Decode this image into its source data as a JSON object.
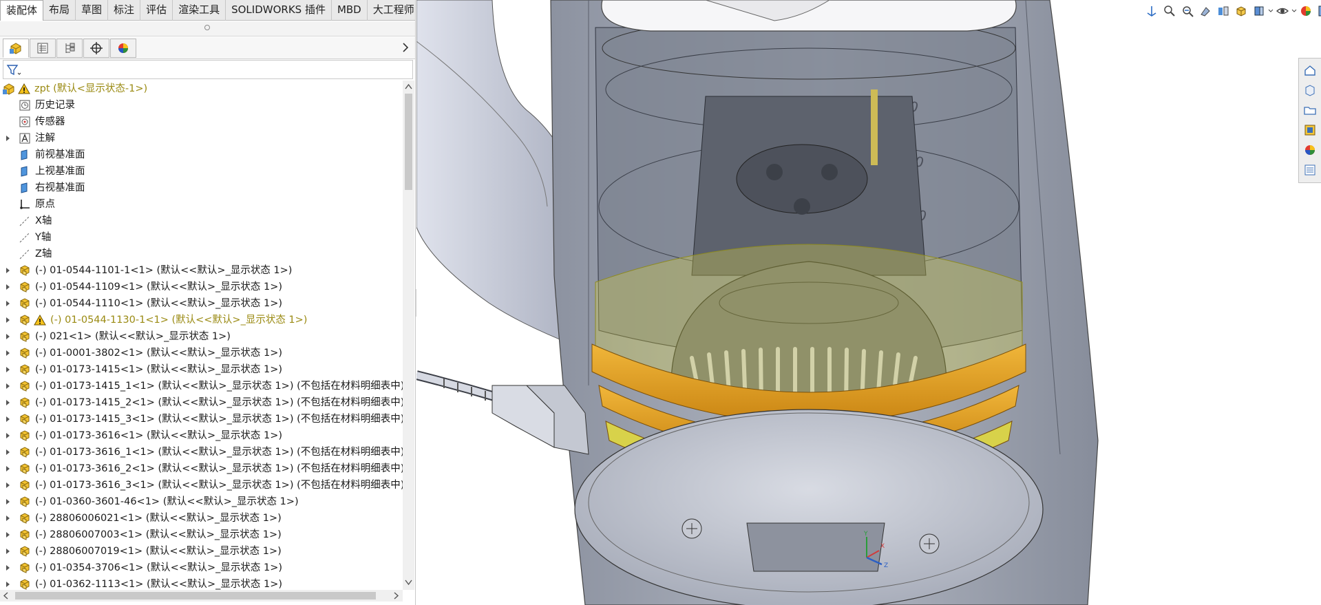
{
  "command_tabs": [
    {
      "label": "装配体",
      "active": true
    },
    {
      "label": "布局"
    },
    {
      "label": "草图"
    },
    {
      "label": "标注"
    },
    {
      "label": "评估"
    },
    {
      "label": "渲染工具"
    },
    {
      "label": "SOLIDWORKS 插件"
    },
    {
      "label": "MBD"
    },
    {
      "label": "大工程师"
    }
  ],
  "feature_tree": {
    "root": {
      "label": "zpt  (默认<显示状态-1>)",
      "warning": true
    },
    "items": [
      {
        "label": "历史记录",
        "icon": "history-icon"
      },
      {
        "label": "传感器",
        "icon": "sensor-icon"
      },
      {
        "label": "注解",
        "icon": "annotation-icon",
        "expandable": true
      },
      {
        "label": "前视基准面",
        "icon": "plane-icon"
      },
      {
        "label": "上视基准面",
        "icon": "plane-icon"
      },
      {
        "label": "右视基准面",
        "icon": "plane-icon"
      },
      {
        "label": "原点",
        "icon": "origin-icon"
      },
      {
        "label": "X轴",
        "icon": "axis-icon"
      },
      {
        "label": "Y轴",
        "icon": "axis-icon"
      },
      {
        "label": "Z轴",
        "icon": "axis-icon"
      }
    ],
    "components": [
      {
        "label": "(-) 01-0544-1101-1<1> (默认<<默认>_显示状态 1>)"
      },
      {
        "label": "(-) 01-0544-1109<1> (默认<<默认>_显示状态 1>)"
      },
      {
        "label": "(-) 01-0544-1110<1> (默认<<默认>_显示状态 1>)"
      },
      {
        "label": "(-) 01-0544-1130-1<1> (默认<<默认>_显示状态 1>)",
        "warning": true
      },
      {
        "label": "(-) 021<1> (默认<<默认>_显示状态 1>)"
      },
      {
        "label": "(-) 01-0001-3802<1> (默认<<默认>_显示状态 1>)"
      },
      {
        "label": "(-) 01-0173-1415<1> (默认<<默认>_显示状态 1>)"
      },
      {
        "label": "(-) 01-0173-1415_1<1> (默认<<默认>_显示状态 1>) (不包括在材料明细表中)"
      },
      {
        "label": "(-) 01-0173-1415_2<1> (默认<<默认>_显示状态 1>) (不包括在材料明细表中)"
      },
      {
        "label": "(-) 01-0173-1415_3<1> (默认<<默认>_显示状态 1>) (不包括在材料明细表中)"
      },
      {
        "label": "(-) 01-0173-3616<1> (默认<<默认>_显示状态 1>)"
      },
      {
        "label": "(-) 01-0173-3616_1<1> (默认<<默认>_显示状态 1>) (不包括在材料明细表中)"
      },
      {
        "label": "(-) 01-0173-3616_2<1> (默认<<默认>_显示状态 1>) (不包括在材料明细表中)"
      },
      {
        "label": "(-) 01-0173-3616_3<1> (默认<<默认>_显示状态 1>) (不包括在材料明细表中)"
      },
      {
        "label": "(-) 01-0360-3601-46<1> (默认<<默认>_显示状态 1>)"
      },
      {
        "label": "(-) 28806006021<1> (默认<<默认>_显示状态 1>)"
      },
      {
        "label": "(-) 28806007003<1> (默认<<默认>_显示状态 1>)"
      },
      {
        "label": "(-) 28806007019<1> (默认<<默认>_显示状态 1>)"
      },
      {
        "label": "(-) 01-0354-3706<1> (默认<<默认>_显示状态 1>)"
      },
      {
        "label": "(-) 01-0362-1113<1> (默认<<默认>_显示状态 1>)"
      }
    ]
  },
  "viewport": {
    "scale_marks": [
      "800",
      "600",
      "400"
    ],
    "triad": {
      "x": "X",
      "y": "Y",
      "z": "Z"
    }
  },
  "colors": {
    "warning_text": "#9a8a12",
    "ring_orange": "#e8a21c",
    "ring_yellow": "#d8d24a",
    "body_grey": "#9aa0ad"
  }
}
